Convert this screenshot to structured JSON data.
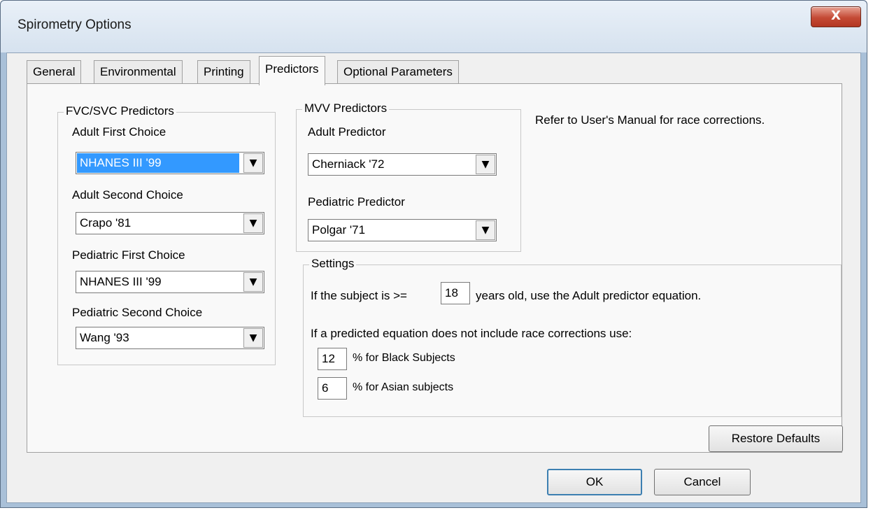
{
  "window": {
    "title": "Spirometry Options",
    "close_glyph": "X"
  },
  "tabs": [
    {
      "label": "General"
    },
    {
      "label": "Environmental"
    },
    {
      "label": "Printing"
    },
    {
      "label": "Predictors",
      "active": true
    },
    {
      "label": "Optional Parameters"
    }
  ],
  "fvc_group": {
    "title": "FVC/SVC Predictors",
    "adult_first_label": "Adult First Choice",
    "adult_first_value": "NHANES III '99",
    "adult_second_label": "Adult Second Choice",
    "adult_second_value": "Crapo '81",
    "ped_first_label": "Pediatric First Choice",
    "ped_first_value": "NHANES III '99",
    "ped_second_label": "Pediatric Second Choice",
    "ped_second_value": "Wang '93"
  },
  "mvv_group": {
    "title": "MVV Predictors",
    "adult_label": "Adult Predictor",
    "adult_value": "Cherniack '72",
    "ped_label": "Pediatric Predictor",
    "ped_value": "Polgar '71"
  },
  "note": "Refer to User's Manual for race corrections.",
  "settings": {
    "title": "Settings",
    "age_prefix": "If the subject is >=",
    "age_value": "18",
    "age_suffix": "years old, use the Adult predictor equation.",
    "race_intro": "If a predicted equation does not include race corrections use:",
    "black_value": "12",
    "black_label": "% for Black Subjects",
    "asian_value": "6",
    "asian_label": "% for Asian subjects"
  },
  "buttons": {
    "restore": "Restore Defaults",
    "ok": "OK",
    "cancel": "Cancel"
  },
  "icons": {
    "dropdown": "chevron-down-icon",
    "close": "close-icon"
  },
  "colors": {
    "selection": "#3399ff",
    "close_button": "#c44a35",
    "dialog_face": "#f0f0f0"
  }
}
